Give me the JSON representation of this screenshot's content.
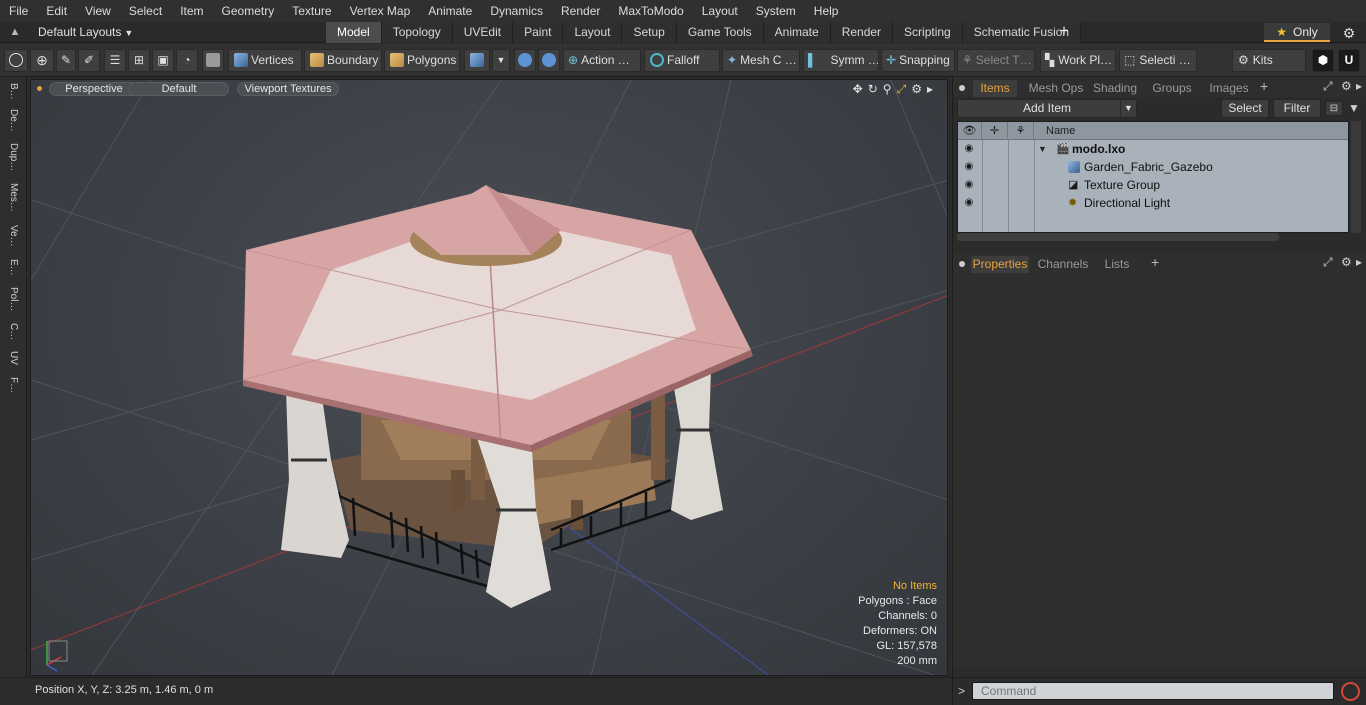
{
  "menu": [
    "File",
    "Edit",
    "View",
    "Select",
    "Item",
    "Geometry",
    "Texture",
    "Vertex Map",
    "Animate",
    "Dynamics",
    "Render",
    "MaxToModo",
    "Layout",
    "System",
    "Help"
  ],
  "layout_selector": "Default Layouts",
  "mode_tabs": [
    {
      "label": "Model",
      "active": true
    },
    {
      "label": "Topology",
      "active": false
    },
    {
      "label": "UVEdit",
      "active": false
    },
    {
      "label": "Paint",
      "active": false
    },
    {
      "label": "Layout",
      "active": false
    },
    {
      "label": "Setup",
      "active": false
    },
    {
      "label": "Game Tools",
      "active": false
    },
    {
      "label": "Animate",
      "active": false
    },
    {
      "label": "Render",
      "active": false
    },
    {
      "label": "Scripting",
      "active": false
    },
    {
      "label": "Schematic Fusion",
      "active": false
    }
  ],
  "add_tab_symbol": "+",
  "only_label": "Only",
  "toolbar": {
    "vertices": "Vertices",
    "boundary": "Boundary",
    "polygons": "Polygons",
    "action": "Action",
    "action_more": "…",
    "falloff": "Falloff",
    "mesh": "Mesh C …",
    "symm": "Symm …",
    "snapping": "Snapping",
    "select_t": "Select T…",
    "work_plane": "Work Pl…",
    "selecti": "Selecti …",
    "kits": "Kits"
  },
  "left_tabs": [
    "B…",
    "De…",
    "Dup…",
    "Mes…",
    "Ve…",
    "E…",
    "Pol…",
    "C…",
    "UV",
    "F…"
  ],
  "viewport": {
    "perspective": "Perspective",
    "shading": "Default",
    "textures": "Viewport Textures",
    "info": {
      "selection": "No Items",
      "polygons": "Polygons : Face",
      "channels": "Channels: 0",
      "deformers": "Deformers: ON",
      "gl": "GL: 157,578",
      "scale": "200 mm"
    }
  },
  "status": {
    "position": "Position X, Y, Z:   3.25 m, 1.46 m, 0 m"
  },
  "items_panel": {
    "tabs": [
      "Items",
      "Mesh Ops",
      "Shading",
      "Groups",
      "Images"
    ],
    "add_item": "Add Item",
    "select": "Select",
    "filter": "Filter",
    "name_header": "Name",
    "items": [
      {
        "label": "modo.lxo",
        "icon": "scene-icon"
      },
      {
        "label": "Garden_Fabric_Gazebo",
        "icon": "mesh-icon"
      },
      {
        "label": "Texture Group",
        "icon": "texture-group-icon"
      },
      {
        "label": "Directional Light",
        "icon": "light-icon"
      }
    ]
  },
  "properties_panel": {
    "tabs": [
      "Properties",
      "Channels",
      "Lists"
    ]
  },
  "command": {
    "prompt": ">",
    "placeholder": "Command"
  },
  "colors": {
    "accent": "#e8a33c",
    "roof": "#d99a9a",
    "wood": "#8a6a4c"
  }
}
